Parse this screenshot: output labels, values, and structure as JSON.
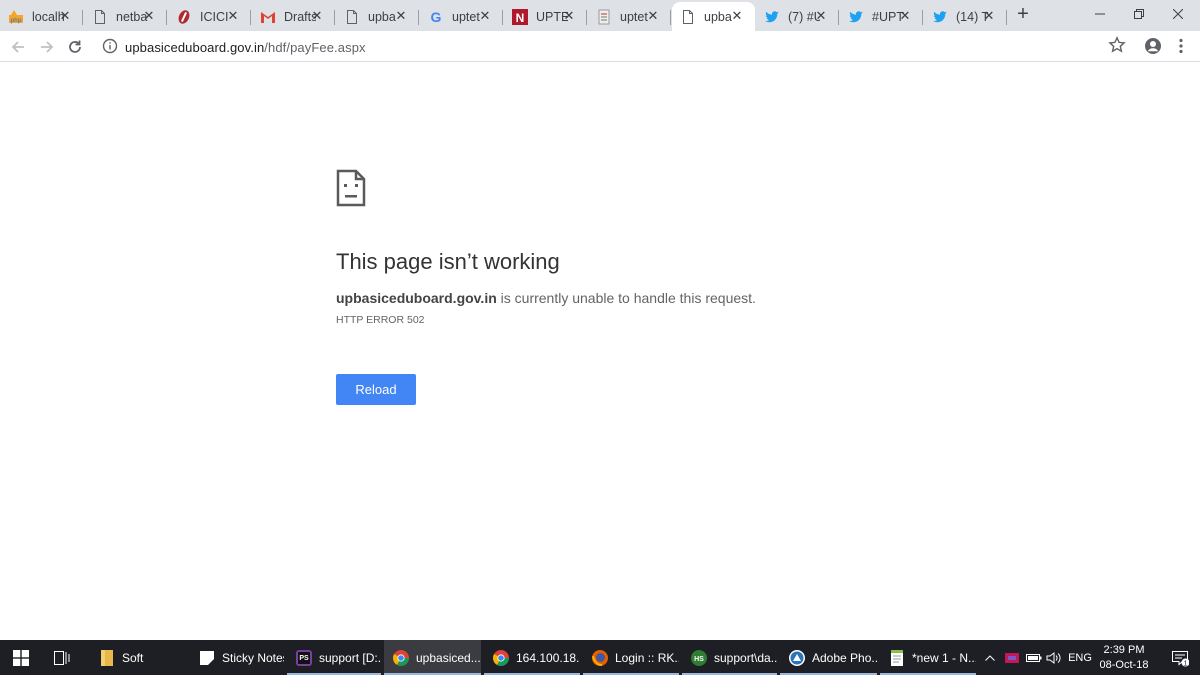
{
  "tabs": [
    {
      "label": "localh",
      "icon": "pma-icon"
    },
    {
      "label": "netba",
      "icon": "page-icon"
    },
    {
      "label": "ICICI",
      "icon": "icici-icon"
    },
    {
      "label": "Drafts",
      "icon": "gmail-icon"
    },
    {
      "label": "upba",
      "icon": "page-icon"
    },
    {
      "label": "uptet",
      "icon": "google-icon"
    },
    {
      "label": "UPTE",
      "icon": "n-icon"
    },
    {
      "label": "uptet",
      "icon": "doc-icon"
    },
    {
      "label": "upba",
      "icon": "page-icon",
      "active": true
    },
    {
      "label": "(7) #U",
      "icon": "twitter-icon"
    },
    {
      "label": "#UPT",
      "icon": "twitter-icon"
    },
    {
      "label": "(14) T",
      "icon": "twitter-icon"
    }
  ],
  "address_bar": {
    "host": "upbasiceduboard.gov.in",
    "path": "/hdf/payFee.aspx"
  },
  "error": {
    "title": "This page isn’t working",
    "host": "upbasiceduboard.gov.in",
    "message": " is currently unable to handle this request.",
    "code": "HTTP ERROR 502",
    "reload_label": "Reload"
  },
  "taskbar": {
    "items": [
      {
        "label": "Soft",
        "icon": "folder-icon",
        "color": "#e8b84a"
      },
      {
        "label": "Sticky Notes",
        "icon": "sticky-notes-icon",
        "color": "#ffffff"
      },
      {
        "label": "support [D:...",
        "icon": "phpstorm-icon",
        "color": "#7b3fa0"
      },
      {
        "label": "upbasiced...",
        "icon": "chrome-icon",
        "color": "#4285f4",
        "active": true
      },
      {
        "label": "164.100.18...",
        "icon": "chrome-icon",
        "color": "#4285f4"
      },
      {
        "label": "Login :: RK...",
        "icon": "firefox-icon",
        "color": "#e66000"
      },
      {
        "label": "support\\da...",
        "icon": "heidisql-icon",
        "color": "#2e7d32"
      },
      {
        "label": "Adobe Pho...",
        "icon": "photoshop-icon",
        "color": "#2a74b8"
      },
      {
        "label": "*new 1 - N...",
        "icon": "notepad-plus-icon",
        "color": "#8bc34a"
      }
    ],
    "language": "ENG",
    "time": "2:39 PM",
    "date": "08-Oct-18",
    "notification_count": "1"
  }
}
